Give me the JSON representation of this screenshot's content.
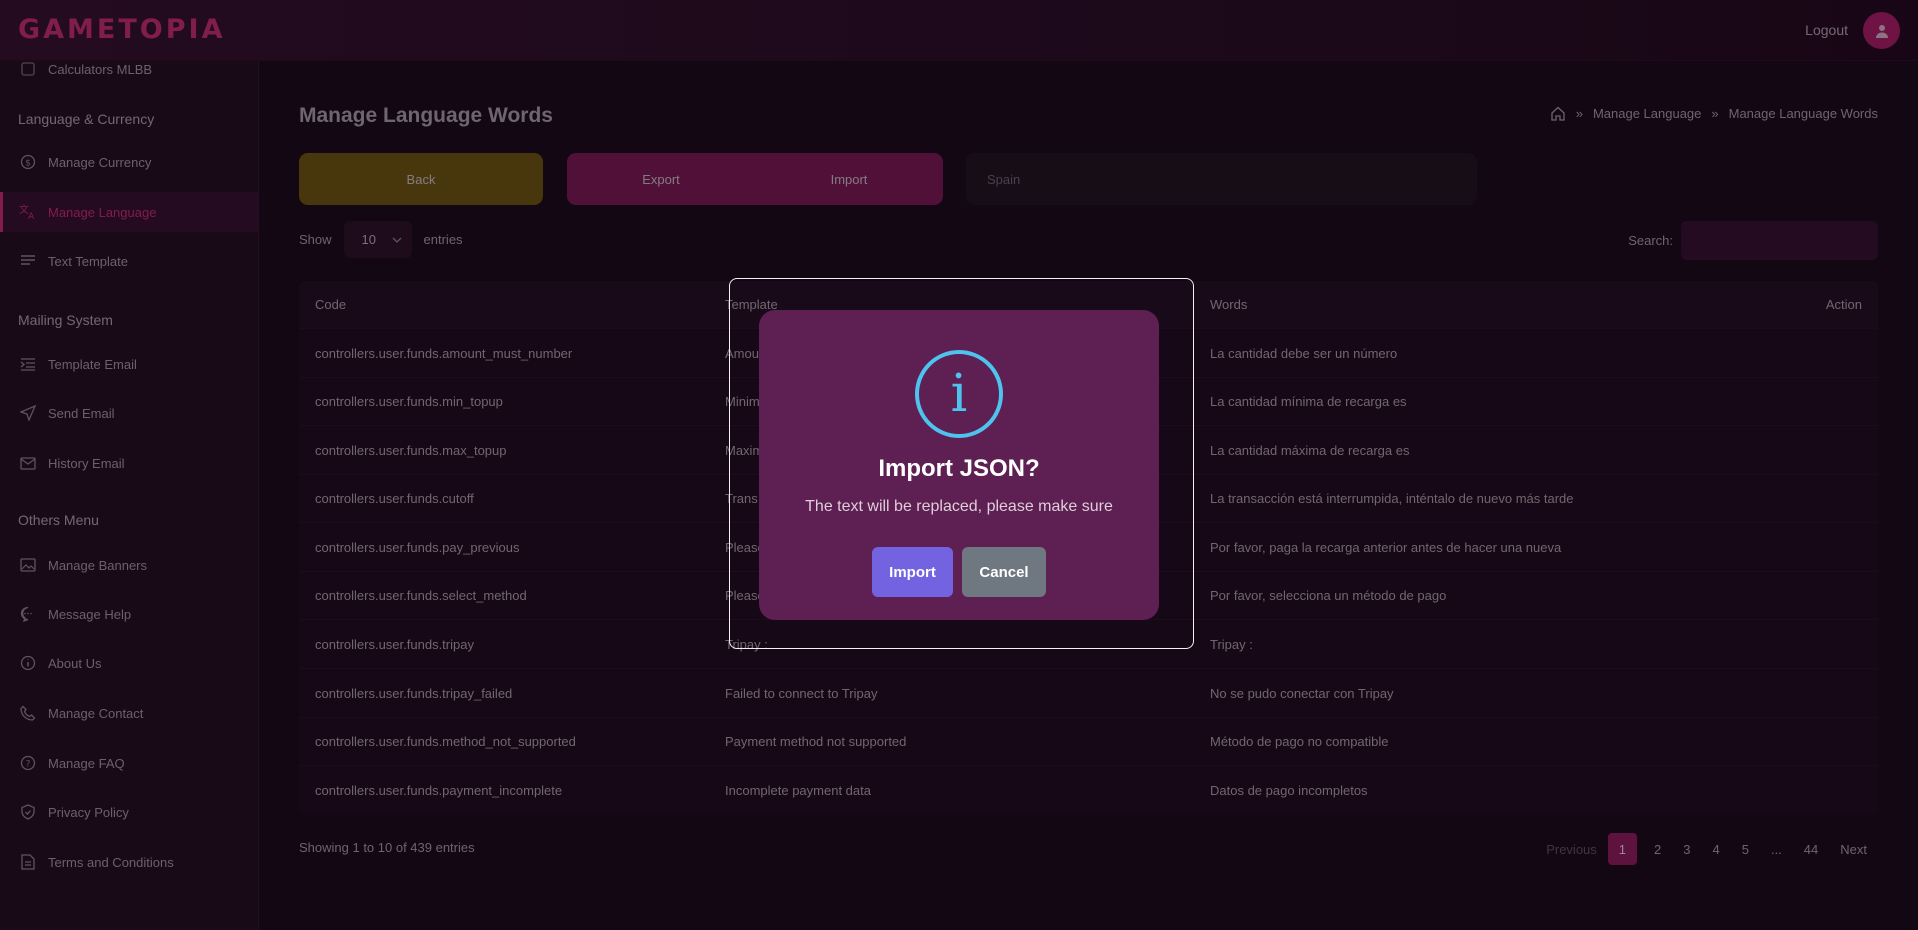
{
  "header": {
    "logo": "GAMETOPIA",
    "logout": "Logout"
  },
  "sidebar": {
    "partial_item": "Calculators MLBB",
    "sections": [
      {
        "title": "Language & Currency",
        "items": [
          {
            "label": "Manage Currency",
            "icon": "dollar-icon"
          },
          {
            "label": "Manage Language",
            "icon": "translate-icon",
            "active": true
          },
          {
            "label": "Text Template",
            "icon": "text-lines-icon"
          }
        ]
      },
      {
        "title": "Mailing System",
        "items": [
          {
            "label": "Template Email",
            "icon": "list-indent-icon"
          },
          {
            "label": "Send Email",
            "icon": "send-icon"
          },
          {
            "label": "History Email",
            "icon": "mail-icon"
          }
        ]
      },
      {
        "title": "Others Menu",
        "items": [
          {
            "label": "Manage Banners",
            "icon": "image-icon"
          },
          {
            "label": "Message Help",
            "icon": "chat-icon"
          },
          {
            "label": "About Us",
            "icon": "info-icon"
          },
          {
            "label": "Manage Contact",
            "icon": "phone-icon"
          },
          {
            "label": "Manage FAQ",
            "icon": "question-icon"
          },
          {
            "label": "Privacy Policy",
            "icon": "shield-icon"
          },
          {
            "label": "Terms and Conditions",
            "icon": "document-icon"
          }
        ]
      }
    ]
  },
  "main": {
    "title": "Manage Language Words",
    "breadcrumb": [
      "Manage Language",
      "Manage Language Words"
    ],
    "back_label": "Back",
    "export_label": "Export",
    "import_label": "Import",
    "language_value": "Spain",
    "show_label": "Show",
    "entries_value": "10",
    "entries_label": "entries",
    "search_label": "Search:"
  },
  "table": {
    "columns": [
      "Code",
      "Template",
      "Words",
      "Action"
    ],
    "rows": [
      {
        "code": "controllers.user.funds.amount_must_number",
        "template": "Amou",
        "words": "La cantidad debe ser un número"
      },
      {
        "code": "controllers.user.funds.min_topup",
        "template": "Minim",
        "words": "La cantidad mínima de recarga es"
      },
      {
        "code": "controllers.user.funds.max_topup",
        "template": "Maxim",
        "words": "La cantidad máxima de recarga es"
      },
      {
        "code": "controllers.user.funds.cutoff",
        "template": "Trans",
        "words": "La transacción está interrumpida, inténtalo de nuevo más tarde"
      },
      {
        "code": "controllers.user.funds.pay_previous",
        "template": "Please",
        "words": "Por favor, paga la recarga anterior antes de hacer una nueva"
      },
      {
        "code": "controllers.user.funds.select_method",
        "template": "Please",
        "words": "Por favor, selecciona un método de pago"
      },
      {
        "code": "controllers.user.funds.tripay",
        "template": "Tripay :",
        "words": "Tripay :"
      },
      {
        "code": "controllers.user.funds.tripay_failed",
        "template": "Failed to connect to Tripay",
        "words": "No se pudo conectar con Tripay"
      },
      {
        "code": "controllers.user.funds.method_not_supported",
        "template": "Payment method not supported",
        "words": "Método de pago no compatible"
      },
      {
        "code": "controllers.user.funds.payment_incomplete",
        "template": "Incomplete payment data",
        "words": "Datos de pago incompletos"
      }
    ]
  },
  "footer": {
    "info": "Showing 1 to 10 of 439 entries",
    "pager": {
      "previous": "Previous",
      "pages": [
        "1",
        "2",
        "3",
        "4",
        "5",
        "...",
        "44"
      ],
      "next": "Next"
    }
  },
  "modal": {
    "icon_glyph": "i",
    "title": "Import JSON?",
    "text": "The text will be replaced, please make sure",
    "confirm": "Import",
    "cancel": "Cancel"
  },
  "colors": {
    "accent": "#e2327f",
    "back_button": "#7b610d",
    "import_button": "#7463e0",
    "info_icon": "#4ec3ee"
  }
}
